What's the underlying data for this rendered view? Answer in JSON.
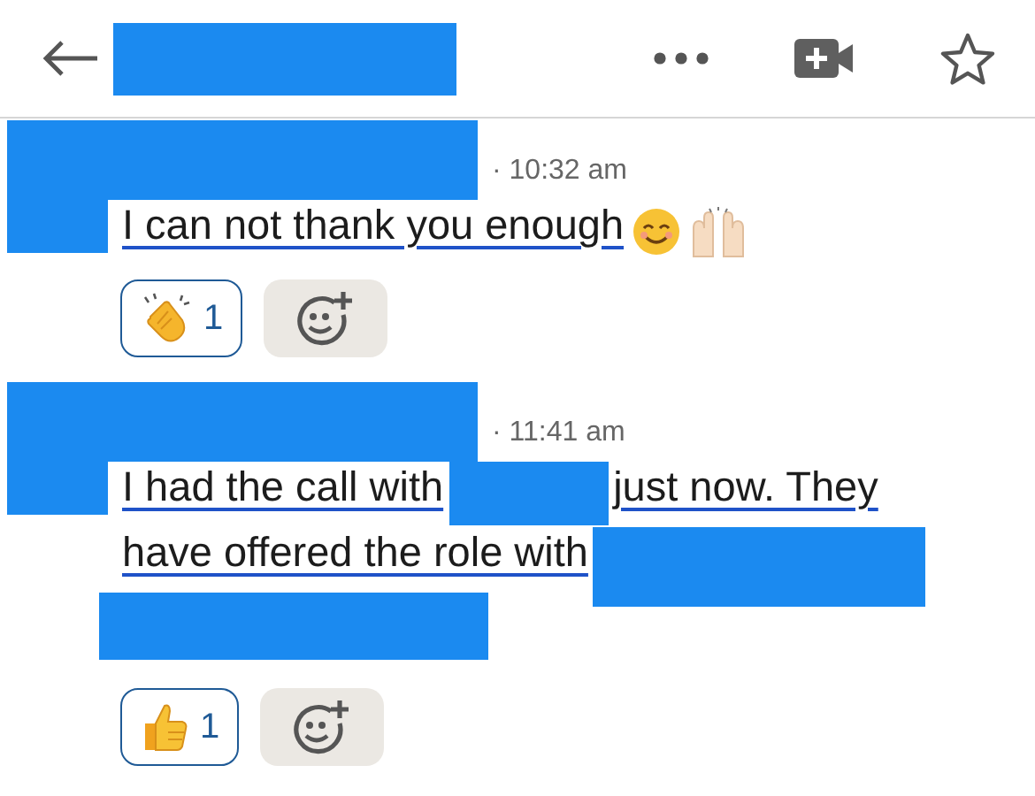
{
  "header": {
    "title_redacted": true
  },
  "messages": [
    {
      "sender_redacted": true,
      "time": "· 10:32 am",
      "lines": [
        [
          {
            "kind": "text",
            "text": "I can not thank you enough",
            "underlined": true
          },
          {
            "kind": "emoji-smile"
          },
          {
            "kind": "emoji-raised-hands"
          }
        ]
      ],
      "reactions": [
        {
          "kind": "clap",
          "count": "1",
          "selected": true
        }
      ]
    },
    {
      "sender_redacted": true,
      "time": "· 11:41 am",
      "lines": [
        [
          {
            "kind": "text",
            "text": "I had the call with",
            "underlined": true
          },
          {
            "kind": "redacted-short"
          },
          {
            "kind": "text",
            "text": "just now. They",
            "underlined": true
          }
        ],
        [
          {
            "kind": "text",
            "text": "have offered the role with",
            "underlined": true
          },
          {
            "kind": "redacted-long"
          }
        ]
      ],
      "trailing_redacted": true,
      "reactions": [
        {
          "kind": "thumbs-up",
          "count": "1",
          "selected": true
        }
      ]
    }
  ]
}
